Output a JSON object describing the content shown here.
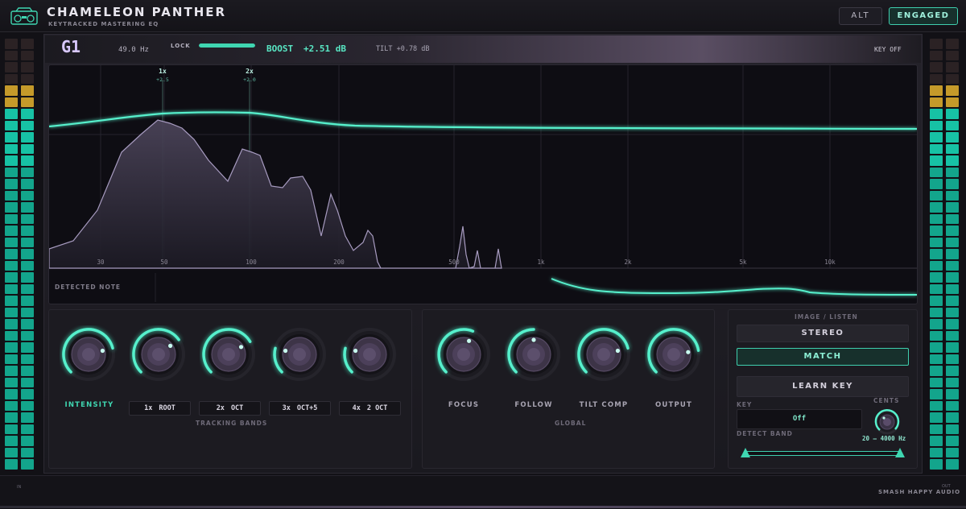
{
  "app": {
    "title": "CHAMELEON PANTHER",
    "subtitle": "KEYTRACKED MASTERING EQ",
    "brand": "SMASH HAPPY AUDIO",
    "meter_in_label": "IN",
    "meter_out_label": "OUT"
  },
  "topbar": {
    "alt_label": "ALT",
    "engaged_label": "ENGAGED"
  },
  "header": {
    "note": "G1",
    "frequency": "49.0 Hz",
    "lock_label": "LOCK",
    "lock_level": 1.0,
    "boost_label": "BOOST",
    "boost_value": "+2.51 dB",
    "tilt": "TILT +0.78 dB",
    "key_status": "KEY OFF"
  },
  "spectrum": {
    "freq_labels": [
      "30",
      "50",
      "100",
      "200",
      "500",
      "1k",
      "2k",
      "5k",
      "10k"
    ],
    "markers": [
      {
        "label": "1x",
        "gain": "+2.5"
      },
      {
        "label": "2x",
        "gain": "+2.0"
      }
    ],
    "detected_note_label": "DETECTED NOTE"
  },
  "tracking": {
    "intensity_label": "INTENSITY",
    "section_label": "TRACKING BANDS",
    "bands": [
      {
        "mult": "1x",
        "name": "ROOT"
      },
      {
        "mult": "2x",
        "name": "OCT"
      },
      {
        "mult": "3x",
        "name": "OCT+5"
      },
      {
        "mult": "4x",
        "name": "2 OCT"
      }
    ],
    "knob_levels": [
      0.78,
      0.7,
      0.72,
      0.22,
      0.22
    ]
  },
  "global": {
    "section_label": "GLOBAL",
    "knobs": [
      {
        "label": "FOCUS",
        "level": 0.58
      },
      {
        "label": "FOLLOW",
        "level": 0.5
      },
      {
        "label": "TILT COMP",
        "level": 0.78
      },
      {
        "label": "OUTPUT",
        "level": 0.8
      }
    ]
  },
  "image_listen": {
    "label": "IMAGE / LISTEN",
    "stereo_label": "STEREO",
    "match_label": "MATCH",
    "learn_key_label": "LEARN KEY",
    "key_label": "KEY",
    "key_value": "Off",
    "cents_label": "CENTS",
    "detect_band_label": "DETECT BAND",
    "detect_range": "20 – 4000 Hz"
  },
  "colors": {
    "accent": "#3fd6b1",
    "note_text": "#d8c8ff",
    "meter_low": "#13a58c",
    "meter_high": "#c59a2a"
  }
}
